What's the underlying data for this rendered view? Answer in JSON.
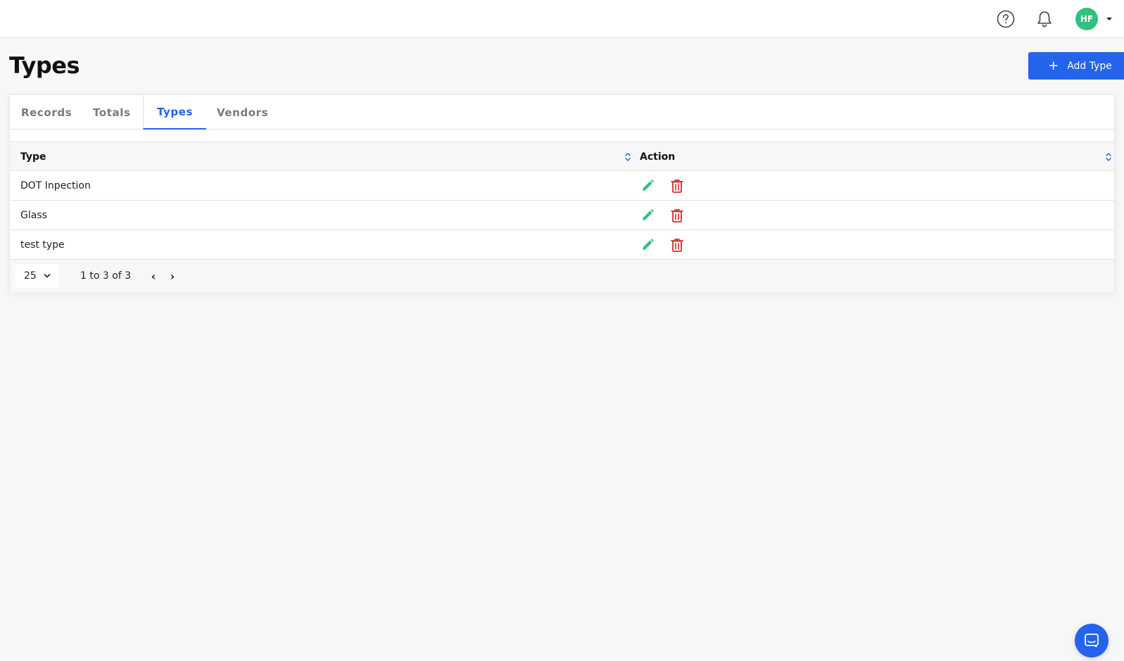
{
  "header": {
    "help_icon": "question-circle-icon",
    "bell_icon": "bell-icon",
    "user_initials": "HF",
    "avatar_color": "#2ec27e"
  },
  "page": {
    "title": "Types",
    "add_button_label": "Add Type",
    "accent_color": "#2463eb"
  },
  "tabs": [
    {
      "label": "Records",
      "active": false
    },
    {
      "label": "Totals",
      "active": false
    },
    {
      "label": "Types",
      "active": true
    },
    {
      "label": "Vendors",
      "active": false
    }
  ],
  "table": {
    "columns": [
      "Type",
      "Action"
    ],
    "rows": [
      {
        "type": "DOT Inpection"
      },
      {
        "type": "Glass"
      },
      {
        "type": "test type"
      }
    ],
    "edit_icon_color": "#2ec27e",
    "delete_icon_color": "#e02424"
  },
  "pagination": {
    "page_size": "25",
    "range_text": "1 to 3 of 3",
    "prev_label": "‹",
    "next_label": "›"
  },
  "chat": {
    "icon": "chat-icon"
  }
}
